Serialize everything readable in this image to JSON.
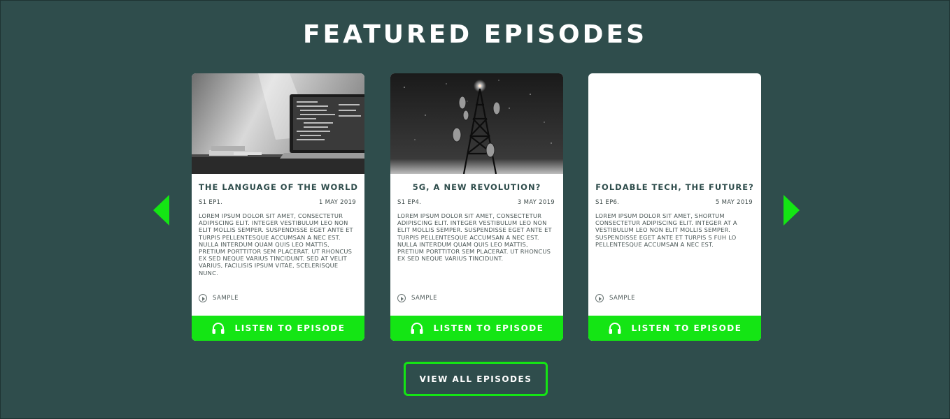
{
  "section": {
    "title": "FEATURED EPISODES",
    "view_all_label": "VIEW ALL EPISODES"
  },
  "colors": {
    "background": "#2f4d4c",
    "accent": "#14e514",
    "card": "#ffffff",
    "heading": "#2f4d4c"
  },
  "icons": {
    "prev": "triangle-left-icon",
    "next": "triangle-right-icon",
    "sample": "play-circle-icon",
    "listen": "headphones-icon"
  },
  "episodes": [
    {
      "title": "THE LANGUAGE OF THE WORLD",
      "code": "S1 EP1.",
      "date": "1 MAY 2019",
      "description": "LOREM IPSUM DOLOR SIT AMET, CONSECTETUR ADIPISCING ELIT. INTEGER VESTIBULUM LEO NON ELIT MOLLIS SEMPER. SUSPENDISSE EGET ANTE ET TURPIS PELLENTESQUE ACCUMSAN A NEC EST. NULLA INTERDUM QUAM QUIS LEO MATTIS, PRETIUM PORTTITOR SEM PLACERAT. UT RHONCUS EX SED NEQUE VARIUS TINCIDUNT. SED AT VELIT VARIUS, FACILISIS IPSUM VITAE, SCELERISQUE NUNC.",
      "sample_label": "SAMPLE",
      "listen_label": "LISTEN TO EPISODE"
    },
    {
      "title": "5G, A NEW REVOLUTION?",
      "code": "S1 EP4.",
      "date": "3 MAY 2019",
      "description": "LOREM IPSUM DOLOR SIT AMET, CONSECTETUR ADIPISCING ELIT. INTEGER VESTIBULUM LEO NON ELIT MOLLIS SEMPER. SUSPENDISSE EGET ANTE ET TURPIS PELLENTESQUE ACCUMSAN A NEC EST. NULLA INTERDUM QUAM QUIS LEO MATTIS, PRETIUM PORTTITOR SEM PLACERAT. UT RHONCUS EX SED NEQUE VARIUS TINCIDUNT.",
      "sample_label": "SAMPLE",
      "listen_label": "LISTEN TO EPISODE"
    },
    {
      "title": "FOLDABLE TECH, THE FUTURE?",
      "code": "S1 EP6.",
      "date": "5 MAY 2019",
      "description": "LOREM IPSUM DOLOR SIT AMET, SHORTUM CONSECTETUR ADIPISCING ELIT. INTEGER AT A VESTIBULUM LEO NON ELIT MOLLIS SEMPER. SUSPENDISSE EGET ANTE ET TURPIS S FUH LO PELLENTESQUE ACCUMSAN A NEC EST.",
      "sample_label": "SAMPLE",
      "listen_label": "LISTEN TO EPISODE"
    }
  ]
}
